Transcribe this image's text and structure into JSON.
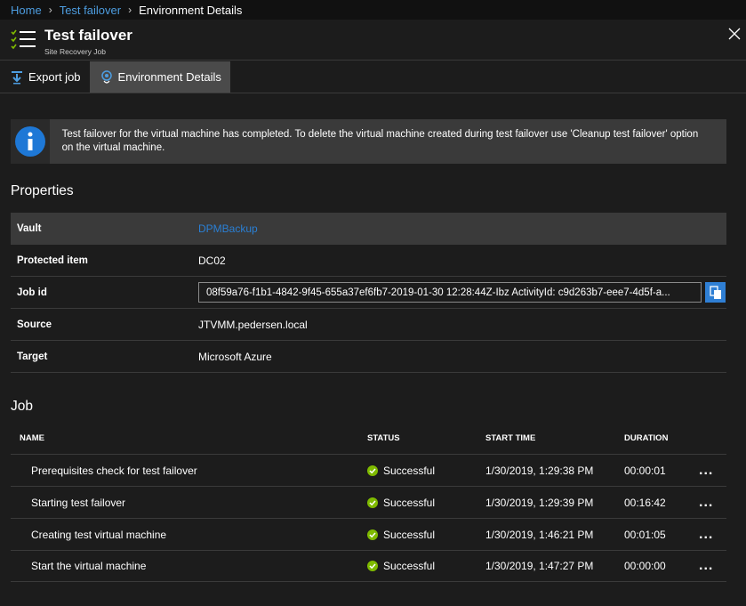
{
  "breadcrumb": {
    "home": "Home",
    "parent": "Test failover",
    "current": "Environment Details"
  },
  "header": {
    "title": "Test failover",
    "subtitle": "Site Recovery Job"
  },
  "toolbar": {
    "export_label": "Export job",
    "env_label": "Environment Details"
  },
  "banner": {
    "message": "Test failover for the virtual machine has completed. To delete the virtual machine created during test failover use 'Cleanup test failover' option on the virtual machine."
  },
  "properties": {
    "title": "Properties",
    "rows": [
      {
        "key": "Vault",
        "value": "DPMBackup"
      },
      {
        "key": "Protected item",
        "value": "DC02"
      },
      {
        "key": "Job id",
        "value": "08f59a76-f1b1-4842-9f45-655a37ef6fb7-2019-01-30 12:28:44Z-Ibz ActivityId: c9d263b7-eee7-4d5f-a..."
      },
      {
        "key": "Source",
        "value": "JTVMM.pedersen.local"
      },
      {
        "key": "Target",
        "value": "Microsoft Azure"
      }
    ]
  },
  "job": {
    "title": "Job",
    "columns": {
      "name": "NAME",
      "status": "STATUS",
      "start": "START TIME",
      "duration": "DURATION"
    },
    "rows": [
      {
        "name": "Prerequisites check for test failover",
        "status": "Successful",
        "start": "1/30/2019, 1:29:38 PM",
        "duration": "00:00:01",
        "more": "..."
      },
      {
        "name": "Starting test failover",
        "status": "Successful",
        "start": "1/30/2019, 1:29:39 PM",
        "duration": "00:16:42",
        "more": "..."
      },
      {
        "name": "Creating test virtual machine",
        "status": "Successful",
        "start": "1/30/2019, 1:46:21 PM",
        "duration": "00:01:05",
        "more": "..."
      },
      {
        "name": "Start the virtual machine",
        "status": "Successful",
        "start": "1/30/2019, 1:47:27 PM",
        "duration": "00:00:00",
        "more": "..."
      }
    ]
  },
  "colors": {
    "accent": "#4d9de0",
    "success": "#7fba00",
    "info": "#1e78d6"
  },
  "icons": {
    "list": "checklist-icon",
    "close": "close-icon",
    "export": "download-icon",
    "env": "globe-pin-icon",
    "info": "info-icon",
    "copy": "copy-icon",
    "success": "check-circle-icon"
  }
}
